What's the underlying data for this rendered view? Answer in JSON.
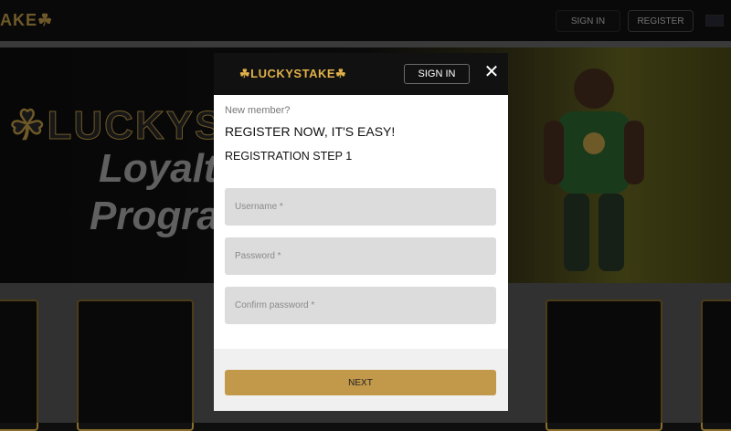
{
  "topbar": {
    "logo_text": "AKE",
    "signin_label": "SIGN IN",
    "register_label": "REGISTER"
  },
  "banner": {
    "brand": "LUCKYST",
    "line1": "Loyalt",
    "line2": "Progra"
  },
  "modal": {
    "logo": "LUCKYSTAKE",
    "signin_label": "SIGN IN",
    "close_glyph": "✕",
    "new_member": "New member?",
    "register_easy": "REGISTER NOW, IT'S EASY!",
    "step": "REGISTRATION STEP 1",
    "fields": {
      "username_placeholder": "Username *",
      "password_placeholder": "Password *",
      "confirm_placeholder": "Confirm password *"
    },
    "next_label": "NEXT"
  },
  "colors": {
    "accent": "#c2984a",
    "gold": "#e0b04a"
  },
  "icons": [
    "clover-icon",
    "close-icon",
    "flag-icon"
  ]
}
